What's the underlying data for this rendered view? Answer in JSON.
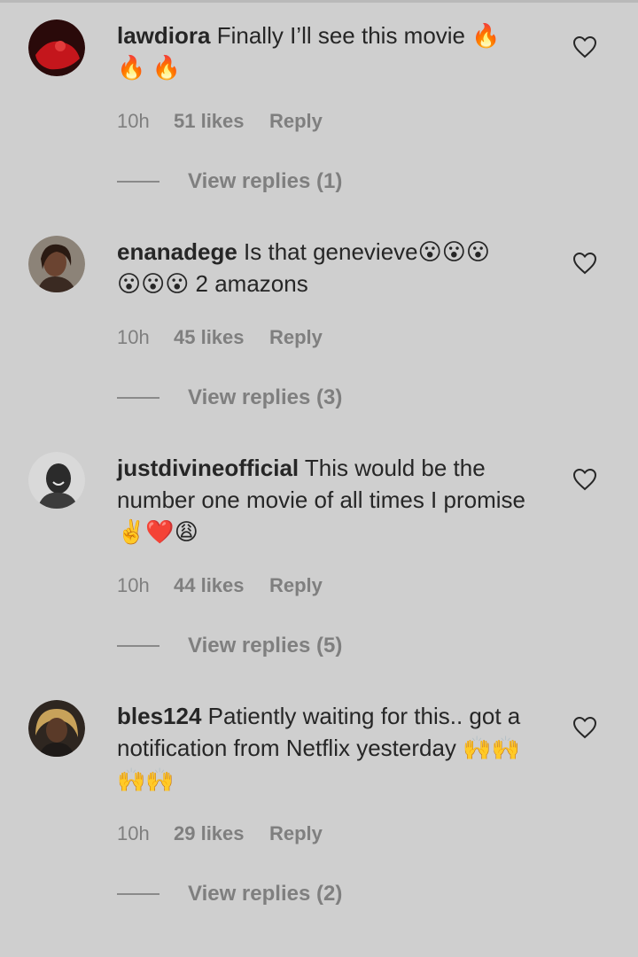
{
  "comments": [
    {
      "username": "lawdiora",
      "text": " Finally I’ll see this movie 🔥\n🔥 🔥",
      "time": "10h",
      "likes": "51 likes",
      "reply": "Reply",
      "view_replies": "View replies (1)"
    },
    {
      "username": "enanadege",
      "text": " Is that genevieve😮😮😮\n😮😮😮 2 amazons",
      "time": "10h",
      "likes": "45 likes",
      "reply": "Reply",
      "view_replies": "View replies (3)"
    },
    {
      "username": "justdivineofficial",
      "text": " This would be the number one movie of all times I promise ✌️❤️😩",
      "time": "10h",
      "likes": "44 likes",
      "reply": "Reply",
      "view_replies": "View replies (5)"
    },
    {
      "username": "bles124",
      "text": " Patiently waiting for this.. got a notification from Netflix yesterday 🙌🙌🙌🙌",
      "time": "10h",
      "likes": "29 likes",
      "reply": "Reply",
      "view_replies": "View replies (2)"
    }
  ],
  "icons": {
    "like": "heart-outline-icon"
  },
  "colors": {
    "background": "#cfcfcf",
    "text": "#262626",
    "secondary_text": "#7f7f7f"
  }
}
